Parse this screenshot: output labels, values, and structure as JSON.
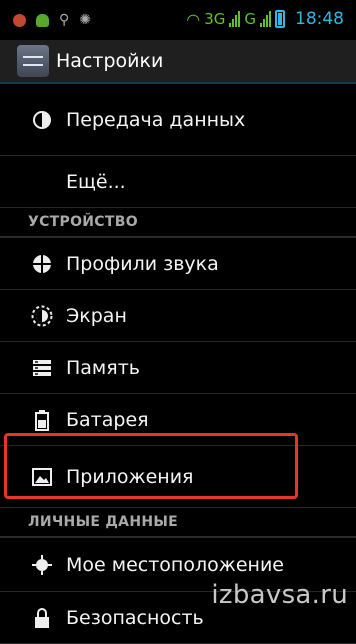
{
  "statusbar": {
    "network_a": "3G",
    "network_b": "G",
    "time": "18:48",
    "left_icons": [
      "app-notification-icon",
      "android-notification-icon",
      "usb-icon",
      "debug-icon"
    ]
  },
  "actionbar": {
    "title": "Настройки"
  },
  "list": {
    "data_transfer": "Передача данных",
    "more": "Ещё...",
    "device_header": "УСТРОЙСТВО",
    "sound_profiles": "Профили звука",
    "screen": "Экран",
    "memory": "Память",
    "battery": "Батарея",
    "apps": "Приложения",
    "personal_header": "ЛИЧНЫЕ ДАННЫЕ",
    "location": "Мое местоположение",
    "security": "Безопасность"
  },
  "watermark": "izbavsa.ru",
  "colors": {
    "accent": "#33b5e5",
    "signal": "#62c12c",
    "highlight": "#e8352a"
  }
}
